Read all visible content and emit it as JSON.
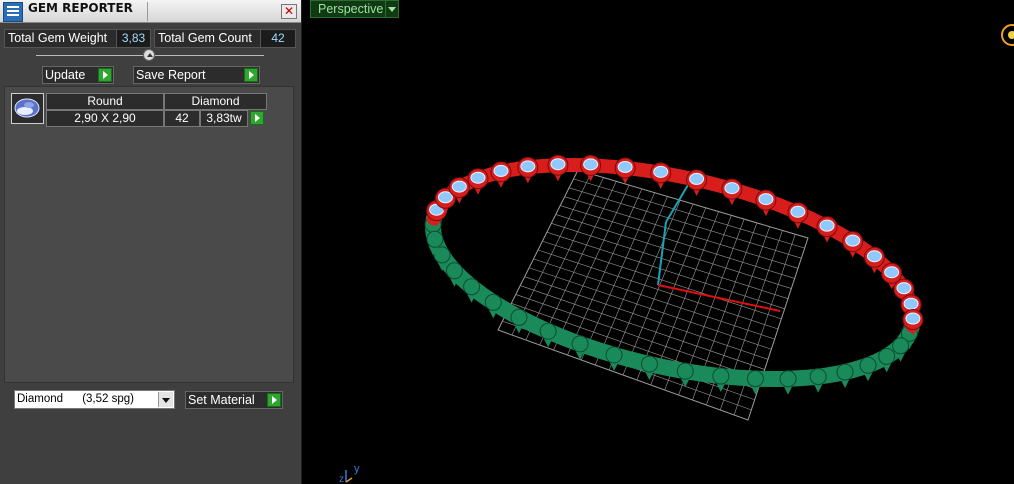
{
  "window": {
    "title": "GEM REPORTER"
  },
  "stats": {
    "weight_label": "Total Gem Weight",
    "weight_value": "3,83",
    "count_label": "Total Gem Count",
    "count_value": "42"
  },
  "buttons": {
    "update": "Update",
    "save_report": "Save Report",
    "set_material": "Set Material"
  },
  "gem_table": {
    "headers": [
      "Round",
      "Diamond"
    ],
    "rows": [
      {
        "size": "2,90 X 2,90",
        "count": "42",
        "weight": "3,83tw"
      }
    ]
  },
  "material_select": {
    "selected": "Diamond      (3,52 spg)"
  },
  "viewport": {
    "view_label": "Perspective",
    "axis_x": "z",
    "axis_y": "y",
    "ring_stones": 42,
    "colors": {
      "gems_top": "#d81d1d",
      "gems_bottom": "#1a8a5a",
      "stone": "#8fc9ff",
      "grid": "#9a9a9a",
      "axis_x": "#e01010",
      "axis_y": "#19a4b8"
    }
  }
}
